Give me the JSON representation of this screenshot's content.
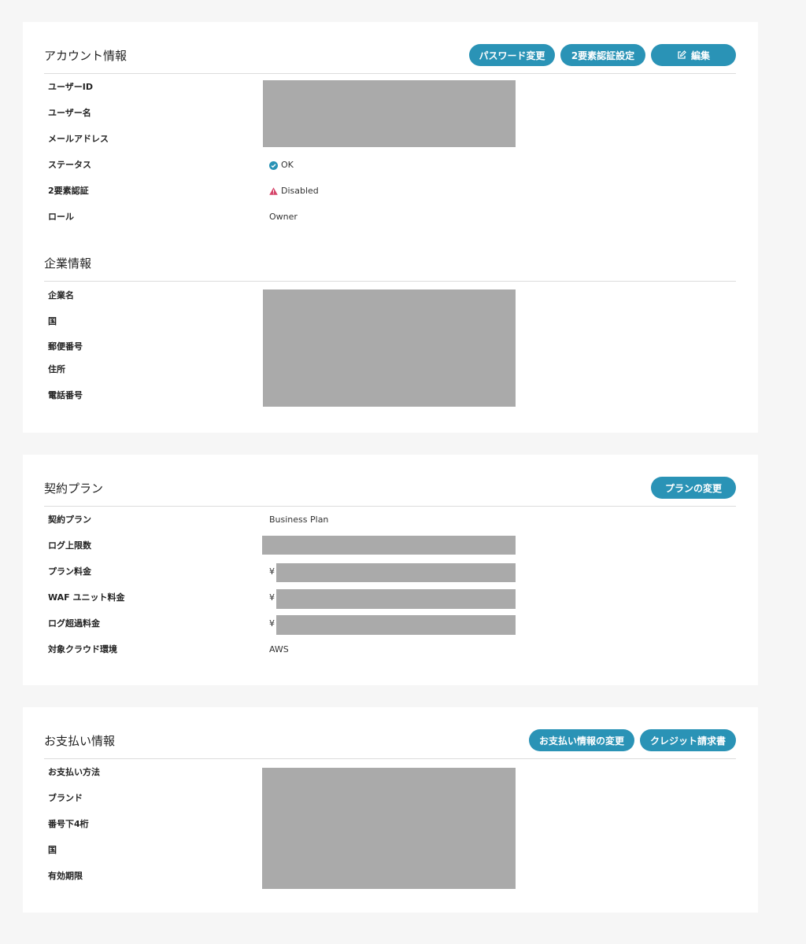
{
  "account": {
    "title": "アカウント情報",
    "buttons": {
      "password": "パスワード変更",
      "two_factor": "2要素認証設定",
      "edit": "編集"
    },
    "labels": [
      "ユーザーID",
      "ユーザー名",
      "メールアドレス",
      "ステータス",
      "2要素認証",
      "ロール"
    ],
    "status": "OK",
    "two_factor_status": "Disabled",
    "role": "Owner"
  },
  "company": {
    "title": "企業情報",
    "labels": [
      "企業名",
      "国",
      "郵便番号",
      "住所",
      "電話番号"
    ]
  },
  "plan": {
    "title": "契約プラン",
    "buttons": {
      "change_plan": "プランの変更"
    },
    "labels": [
      "契約プラン",
      "ログ上限数",
      "プラン料金",
      "WAF ユニット料金",
      "ログ超過料金",
      "対象クラウド環境"
    ],
    "plan_name": "Business Plan",
    "currency_prefix": "¥",
    "cloud": "AWS"
  },
  "payment": {
    "title": "お支払い情報",
    "buttons": {
      "change_payment": "お支払い情報の変更",
      "credit_invoice": "クレジット請求書"
    },
    "labels": [
      "お支払い方法",
      "ブランド",
      "番号下4桁",
      "国",
      "有効期限"
    ]
  },
  "colors": {
    "accent": "#2a93b6",
    "ok": "#2a93b6",
    "warning": "#d6456a",
    "redaction": "#aaaaaa",
    "page_bg": "#f6f6f6"
  },
  "icons": {
    "edit": "edit-icon",
    "ok": "check-circle-icon",
    "warning": "warning-triangle-icon"
  }
}
